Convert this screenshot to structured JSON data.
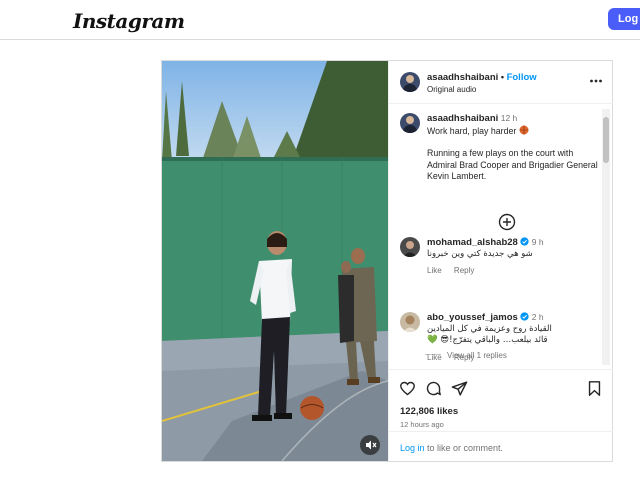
{
  "app": {
    "logo_text": "Instagram",
    "login_label": "Log in"
  },
  "post": {
    "author": {
      "username": "asaadhshaibani",
      "follow_label": "Follow",
      "audio_label": "Original audio"
    },
    "caption": {
      "username": "asaadhshaibani",
      "time": "12 h",
      "line1": "Work hard, play harder",
      "paragraph": "Running a few plays on the court with Admiral Brad Cooper and Brigadier General Kevin Lambert."
    },
    "comments": [
      {
        "username": "mohamad_alshab28",
        "verified": true,
        "time": "9 h",
        "text_lines": [
          "شو هي جديدة كتي وين خبرونا"
        ],
        "like_label": "Like",
        "reply_label": "Reply",
        "view_replies_label": "View all 1 replies"
      },
      {
        "username": "abo_youssef_jamos",
        "verified": true,
        "time": "2 h",
        "text_lines": [
          "القيادة روح وعزيمة في كل الميادين",
          "قائد بيلعب… والباقي يتفرّج!😎 💚"
        ],
        "like_label": "Like",
        "reply_label": "Reply"
      }
    ],
    "likes": "122,806 likes",
    "age": "12 hours ago",
    "login_prompt": {
      "link": "Log in",
      "rest": " to like or comment."
    }
  },
  "icons": {
    "more": "more-horizontal-icon",
    "add_comment": "plus-circle-icon",
    "like": "heart-icon",
    "comment": "comment-icon",
    "share": "share-icon",
    "save": "bookmark-icon",
    "mute": "speaker-muted-icon",
    "verified": "verified-badge-icon"
  },
  "colors": {
    "accent": "#0095f6",
    "login_button": "#4a5df9",
    "text": "#262626",
    "secondary": "#737373"
  }
}
